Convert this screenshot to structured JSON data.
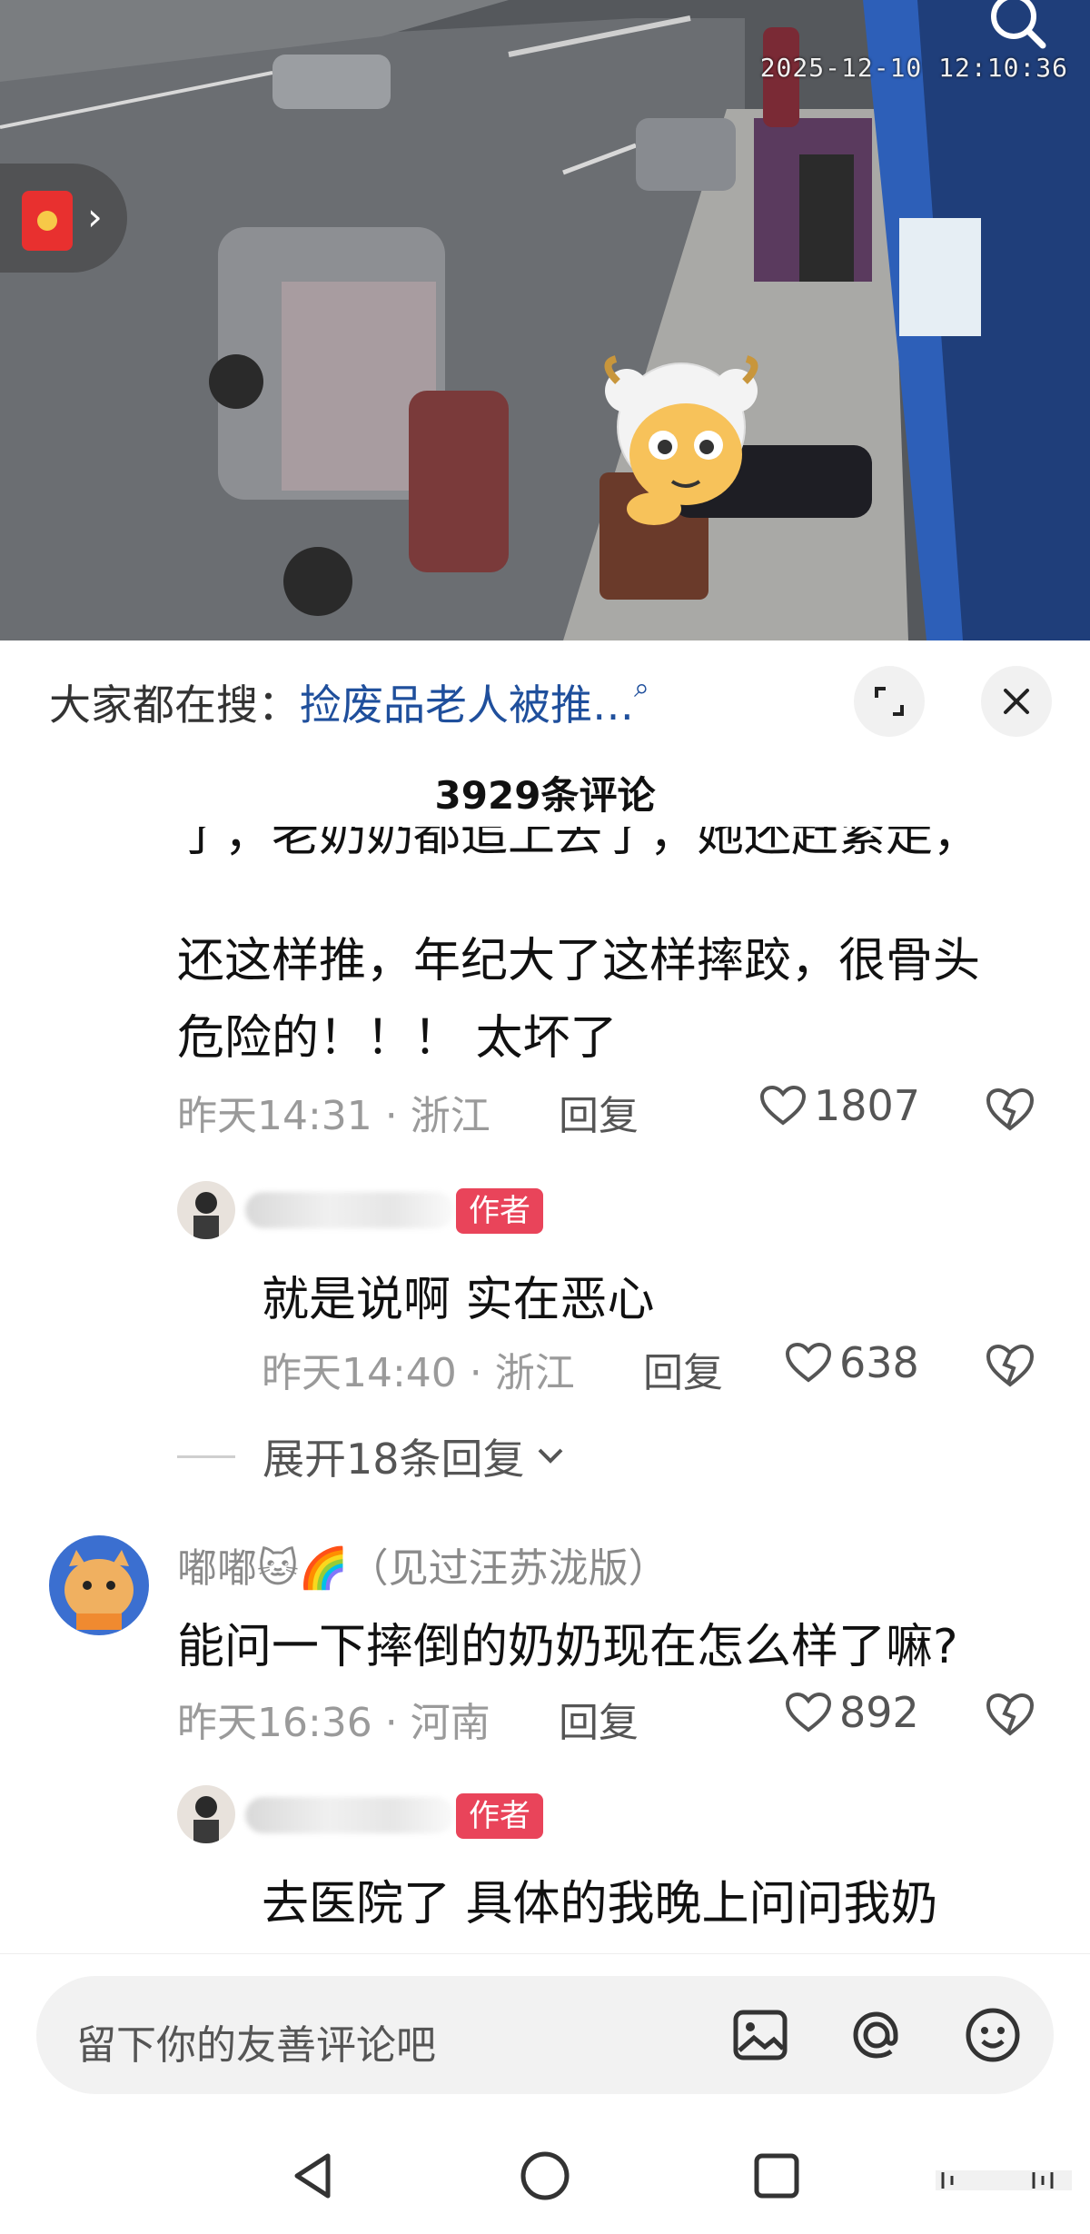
{
  "video": {
    "timestamp": "2025-12-10 12:10:36",
    "overlay_icons": [
      "search-icon",
      "red-packet-icon",
      "chevron-right-icon"
    ]
  },
  "search_bar": {
    "label": "大家都在搜：",
    "term": "捡废品老人被推…",
    "icons": [
      "search-icon",
      "expand-icon",
      "close-icon"
    ]
  },
  "comments_header": {
    "count_text": "3929条评论"
  },
  "comments": [
    {
      "text_clipped": "了，老奶奶都追上去了，她还赶紧走，",
      "text_line1": "还这样推，年纪大了这样摔跤，很骨头",
      "text_line2": "危险的！！！ 太坏了",
      "time": "昨天14:31 · 浙江",
      "reply": "回复",
      "likes": "1807"
    },
    {
      "author_badge": "作者",
      "text": "就是说啊 实在恶心",
      "time": "昨天14:40 · 浙江",
      "reply": "回复",
      "likes": "638"
    },
    {
      "username": "嘟嘟🐱🌈（见过汪苏泷版）",
      "text": "能问一下摔倒的奶奶现在怎么样了嘛?",
      "time": "昨天16:36 · 河南",
      "reply": "回复",
      "likes": "892"
    },
    {
      "author_badge": "作者",
      "text": "去医院了 具体的我晚上问问我奶"
    }
  ],
  "expand_replies": {
    "label": "展开18条回复"
  },
  "input": {
    "placeholder": "留下你的友善评论吧",
    "icons": [
      "image-icon",
      "at-icon",
      "emoji-icon"
    ]
  },
  "nav": {
    "icons": [
      "back-icon",
      "home-icon",
      "recent-apps-icon",
      "menu-icon"
    ]
  },
  "colors": {
    "accent_blue": "#1f4f9c",
    "author_badge": "#e9445a",
    "meta_gray": "#9a9a9a"
  }
}
